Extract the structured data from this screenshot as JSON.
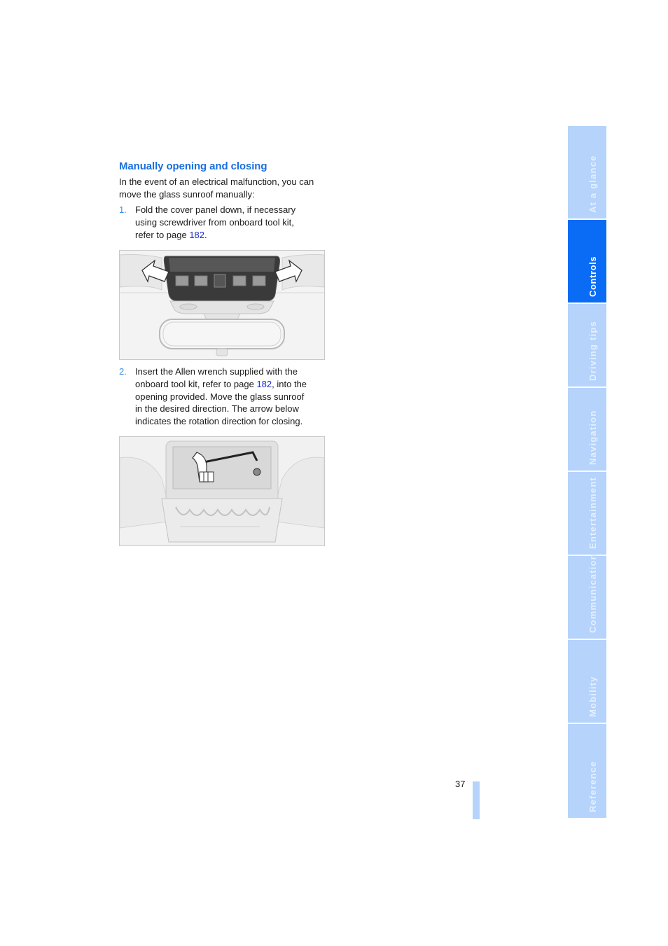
{
  "section": {
    "heading": "Manually opening and closing",
    "intro_line1": "In the event of an electrical malfunction, you can",
    "intro_line2": "move the glass sunroof manually:"
  },
  "steps": [
    {
      "number": "1.",
      "lines": [
        "Fold the cover panel down, if necessary",
        "using screwdriver from onboard tool kit,"
      ],
      "line3_prefix": "refer to page ",
      "link": "182",
      "line3_suffix": "."
    },
    {
      "number": "2.",
      "line1": "Insert the Allen wrench supplied with the",
      "line2_prefix": "onboard tool kit, refer to page ",
      "link": "182",
      "line2_suffix": ", into the",
      "lines_rest": [
        "opening provided. Move the glass sunroof",
        "in the desired direction. The arrow below",
        "indicates the rotation direction for closing."
      ]
    }
  ],
  "figures": [
    {
      "name": "overhead-console-cover-panel",
      "description": "Overhead console with arrows indicating cover panel and rearview mirror"
    },
    {
      "name": "allen-wrench-sunroof-opening",
      "description": "Allen wrench inserted into opening with rotation arrow for closing"
    }
  ],
  "sidebar": {
    "tabs": [
      {
        "label": "At a glance",
        "active": false
      },
      {
        "label": "Controls",
        "active": true
      },
      {
        "label": "Driving tips",
        "active": false
      },
      {
        "label": "Navigation",
        "active": false
      },
      {
        "label": "Entertainment",
        "active": false
      },
      {
        "label": "Communication",
        "active": false
      },
      {
        "label": "Mobility",
        "active": false
      },
      {
        "label": "Reference",
        "active": false
      }
    ]
  },
  "footer": {
    "page_number": "37"
  },
  "colors": {
    "heading": "#1a6fe0",
    "link": "#1a2fd0",
    "tab": "#b5d3fb",
    "tab_active": "#0a6cf5"
  }
}
